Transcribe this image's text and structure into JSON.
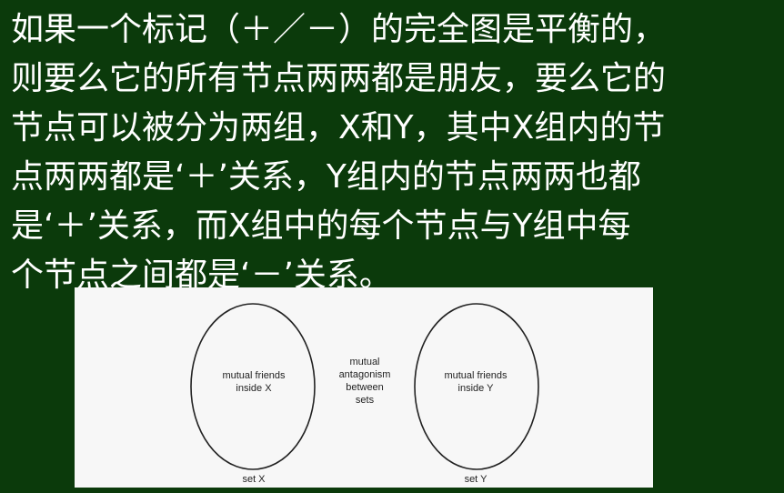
{
  "text": {
    "lines": [
      "如果一个标记（＋／－）的完全图是平衡的，",
      "则要么它的所有节点两两都是朋友，要么它的",
      "节点可以被分为两组，X和Y，其中X组内的节",
      "点两两都是‘＋’关系，Y组内的节点两两也都",
      "是‘＋’关系，而X组中的每个节点与Y组中每",
      "个节点之间都是‘－’关系。"
    ]
  },
  "figure": {
    "left_oval_text": [
      "mutual friends",
      "inside X"
    ],
    "middle_text": [
      "mutual",
      "antagonism",
      "between",
      "sets"
    ],
    "right_oval_text": [
      "mutual friends",
      "inside Y"
    ],
    "left_set_label": "set X",
    "right_set_label": "set Y"
  },
  "colors": {
    "background": "#0b3a0b",
    "text": "#ffffff",
    "figure_background": "#f7f7f7",
    "figure_ink": "#222222"
  }
}
